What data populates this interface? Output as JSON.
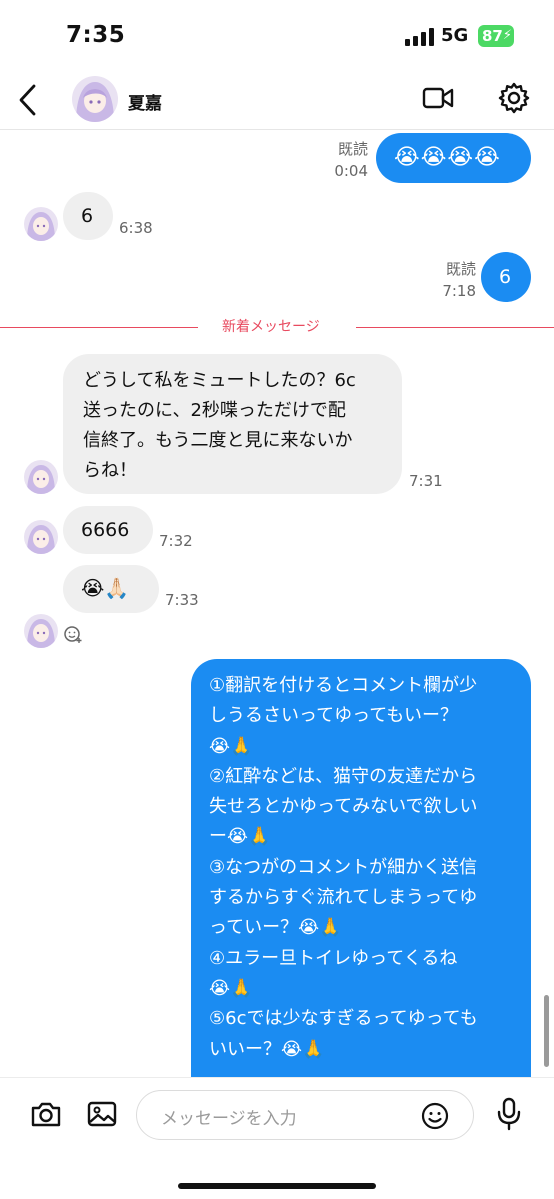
{
  "status_bar": {
    "time": "7:35",
    "network": "5G",
    "battery": "87"
  },
  "header": {
    "contact_name": "夏嘉",
    "icons": [
      "chevron-left-icon",
      "avatar",
      "video-camera-icon",
      "gear-icon"
    ]
  },
  "messages": {
    "m1": {
      "direction": "outgoing",
      "read": "既読",
      "time": "0:04",
      "text": "😭😭😭😭"
    },
    "m2": {
      "direction": "incoming",
      "text": "6",
      "time": "6:38"
    },
    "m3": {
      "direction": "outgoing",
      "read": "既読",
      "time": "7:18",
      "text": "6"
    },
    "m4": {
      "direction": "incoming",
      "line1": "どうして私をミュートしたの？6c",
      "line2": "送ったのに、2秒喋っただけで配",
      "line3": "信終了。もう二度と見に来ないか",
      "line4": "らね！",
      "time": "7:31"
    },
    "m5": {
      "direction": "incoming",
      "text": "6666",
      "time": "7:32"
    },
    "m6": {
      "direction": "incoming",
      "text": "😭🙏🏻",
      "time": "7:33"
    },
    "m7": {
      "direction": "outgoing",
      "lines": [
        "①翻訳を付けるとコメント欄が少",
        "しうるさいってゆってもいー？",
        "😭🙏",
        "②紅酔などは、猫守の友達だから",
        "失せろとかゆってみないで欲しい",
        "ー😭🙏",
        "③なつがのコメントが細かく送信",
        "するからすぐ流れてしまうってゆ",
        "っていー？😭🙏",
        "④ユラー旦トイレゆってくるね",
        "😭🙏",
        "⑤6cでは少なすぎるってゆっても",
        "いいー？😭🙏"
      ]
    }
  },
  "divider": {
    "label": "新着メッセージ",
    "color": "#e84a5f"
  },
  "composer": {
    "placeholder": "メッセージを入力"
  },
  "colors": {
    "outgoing_bubble": "#1b8cf2",
    "incoming_bubble": "#efefef",
    "battery": "#4cd964"
  }
}
